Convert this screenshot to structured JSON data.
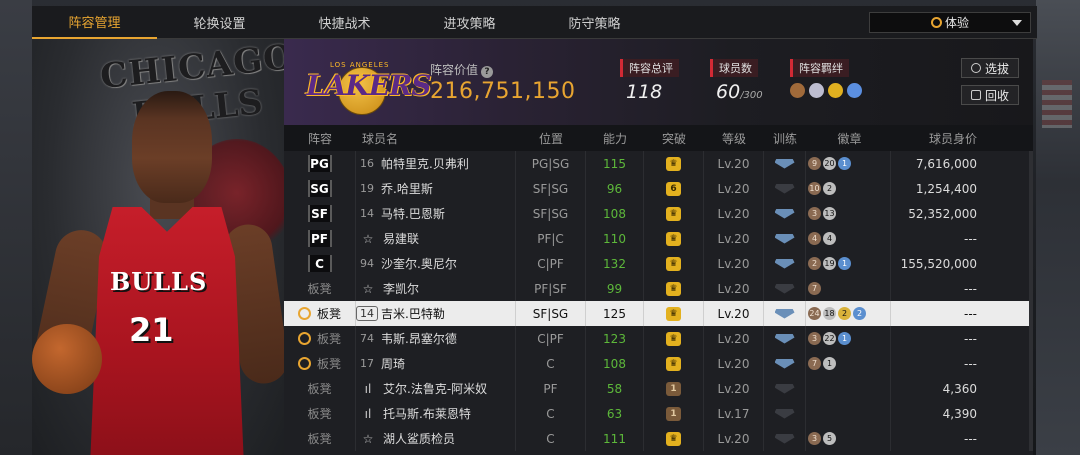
{
  "tabs": [
    "阵容管理",
    "轮换设置",
    "快捷战术",
    "进攻策略",
    "防守策略"
  ],
  "active_tab": 0,
  "mode": {
    "label": "体验"
  },
  "hero": {
    "team_word_1": "CHICAGO",
    "team_word_2": "BULLS",
    "jersey_text": "BULLS",
    "jersey_number": "21"
  },
  "team": {
    "logo_text": "LAKERS",
    "logo_small": "LOS ANGELES",
    "value_label": "阵容价值",
    "value": "216,751,150",
    "rating_label": "阵容总评",
    "rating": "118",
    "players_label": "球员数",
    "players": "60",
    "players_max": "/300",
    "chemistry_label": "阵容羁绊",
    "select_btn": "选拔",
    "recycle_btn": "回收"
  },
  "columns": {
    "pos": "阵容",
    "name": "球员名",
    "position": "位置",
    "ability": "能力",
    "break": "突破",
    "level": "等级",
    "train": "训练",
    "badge": "徽章",
    "price": "球员身价"
  },
  "colors": {
    "accent": "#e8a531",
    "ability_green": "#5db83a",
    "stat_red": "#d22a35",
    "lakers_purple": "#5b2a86",
    "lakers_gold": "#fdb927"
  },
  "rows": [
    {
      "slot": "PG",
      "no": "16",
      "name": "帕特里克.贝弗利",
      "position": "PG|SG",
      "ability": "115",
      "break": "",
      "level": "Lv.20",
      "badges": [
        "9",
        "20",
        "1"
      ],
      "price": "7,616,000"
    },
    {
      "slot": "SG",
      "no": "19",
      "name": "乔.哈里斯",
      "position": "SF|SG",
      "ability": "96",
      "break": "6",
      "level": "Lv.20",
      "badges": [
        "10",
        "2"
      ],
      "price": "1,254,400"
    },
    {
      "slot": "SF",
      "no": "14",
      "name": "马特.巴恩斯",
      "position": "SF|SG",
      "ability": "108",
      "break": "",
      "level": "Lv.20",
      "badges": [
        "3",
        "13"
      ],
      "price": "52,352,000"
    },
    {
      "slot": "PF",
      "no": "☆",
      "name": "易建联",
      "position": "PF|C",
      "ability": "110",
      "break": "",
      "level": "Lv.20",
      "badges": [
        "4",
        "4"
      ],
      "price": "---"
    },
    {
      "slot": "C",
      "no": "94",
      "name": "沙奎尔.奥尼尔",
      "position": "C|PF",
      "ability": "132",
      "break": "",
      "level": "Lv.20",
      "badges": [
        "2",
        "19",
        "1"
      ],
      "price": "155,520,000"
    },
    {
      "slot": "板凳",
      "no": "☆",
      "name": "李凯尔",
      "position": "PF|SF",
      "ability": "99",
      "break": "",
      "level": "Lv.20",
      "badges": [
        "7"
      ],
      "price": "---"
    },
    {
      "slot": "板凳",
      "no": "14",
      "name": "吉米.巴特勒",
      "position": "SF|SG",
      "ability": "125",
      "break": "",
      "level": "Lv.20",
      "badges": [
        "24",
        "18",
        "2",
        "2"
      ],
      "price": "---"
    },
    {
      "slot": "板凳",
      "no": "74",
      "name": "韦斯.昂塞尔德",
      "position": "C|PF",
      "ability": "123",
      "break": "",
      "level": "Lv.20",
      "badges": [
        "3",
        "22",
        "1"
      ],
      "price": "---"
    },
    {
      "slot": "板凳",
      "no": "17",
      "name": "周琦",
      "position": "C",
      "ability": "108",
      "break": "",
      "level": "Lv.20",
      "badges": [
        "7",
        "1"
      ],
      "price": "---"
    },
    {
      "slot": "板凳",
      "no": "ıl",
      "name": "艾尔.法鲁克-阿米奴",
      "position": "PF",
      "ability": "58",
      "break": "1",
      "level": "Lv.20",
      "badges": [],
      "price": "4,360"
    },
    {
      "slot": "板凳",
      "no": "ıl",
      "name": "托马斯.布莱恩特",
      "position": "C",
      "ability": "63",
      "break": "1",
      "level": "Lv.17",
      "badges": [],
      "price": "4,390"
    },
    {
      "slot": "板凳",
      "no": "☆",
      "name": "湖人鲨质检员",
      "position": "C",
      "ability": "111",
      "break": "",
      "level": "Lv.20",
      "badges": [
        "3",
        "5"
      ],
      "price": "---"
    }
  ]
}
